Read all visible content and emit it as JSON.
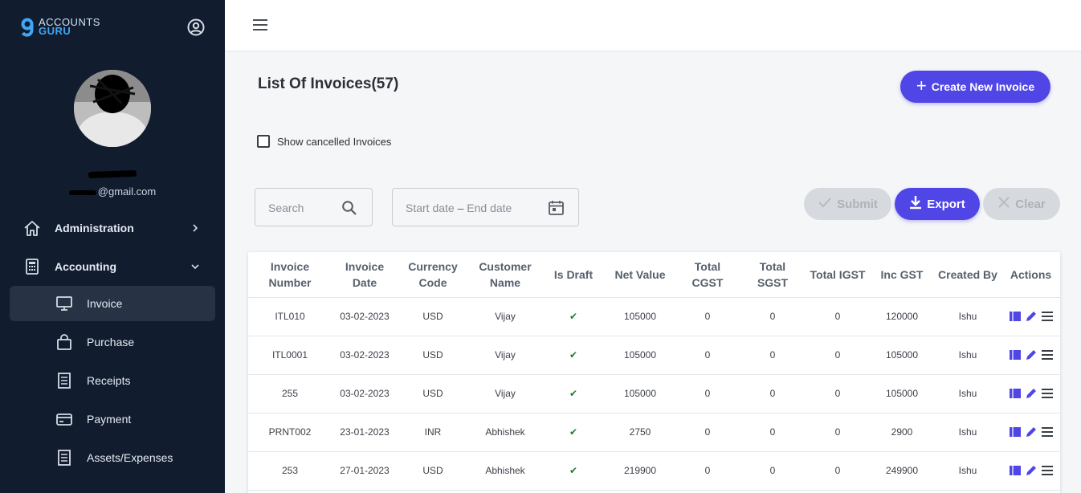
{
  "brand": {
    "line1": "ACCOUNTS",
    "line2": "GURU"
  },
  "user": {
    "email_suffix": "@gmail.com"
  },
  "sidebar": {
    "items": [
      {
        "label": "Administration",
        "icon": "home-icon"
      },
      {
        "label": "Accounting",
        "icon": "calculator-icon"
      },
      {
        "label": "Invoice",
        "icon": "monitor-icon"
      },
      {
        "label": "Purchase",
        "icon": "bag-icon"
      },
      {
        "label": "Receipts",
        "icon": "receipt-icon"
      },
      {
        "label": "Payment",
        "icon": "card-icon"
      },
      {
        "label": "Assets/Expenses",
        "icon": "receipt-icon"
      }
    ]
  },
  "main": {
    "title": "List Of Invoices(57)",
    "create_label": "Create New Invoice",
    "show_cancelled_label": "Show cancelled Invoices",
    "search_placeholder": "Search",
    "date_start_placeholder": "Start date",
    "date_separator": "–",
    "date_end_placeholder": "End date",
    "submit_label": "Submit",
    "export_label": "Export",
    "clear_label": "Clear"
  },
  "table": {
    "headers": [
      "Invoice Number",
      "Invoice Date",
      "Currency Code",
      "Customer Name",
      "Is Draft",
      "Net Value",
      "Total CGST",
      "Total SGST",
      "Total IGST",
      "Inc GST",
      "Created By",
      "Actions"
    ],
    "rows": [
      [
        "ITL010",
        "03-02-2023",
        "USD",
        "Vijay",
        "✔",
        "105000",
        "0",
        "0",
        "0",
        "120000",
        "Ishu"
      ],
      [
        "ITL0001",
        "03-02-2023",
        "USD",
        "Vijay",
        "✔",
        "105000",
        "0",
        "0",
        "0",
        "105000",
        "Ishu"
      ],
      [
        "255",
        "03-02-2023",
        "USD",
        "Vijay",
        "✔",
        "105000",
        "0",
        "0",
        "0",
        "105000",
        "Ishu"
      ],
      [
        "PRNT002",
        "23-01-2023",
        "INR",
        "Abhishek",
        "✔",
        "2750",
        "0",
        "0",
        "0",
        "2900",
        "Ishu"
      ],
      [
        "253",
        "27-01-2023",
        "USD",
        "Abhishek",
        "✔",
        "219900",
        "0",
        "0",
        "0",
        "249900",
        "Ishu"
      ]
    ]
  },
  "colors": {
    "sidebar_bg": "#111c2f",
    "accent": "#4f46e5",
    "check_green": "#1e7a2e"
  }
}
